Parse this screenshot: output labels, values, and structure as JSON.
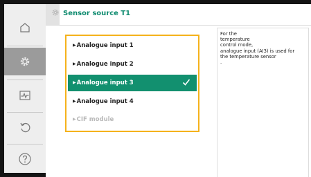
{
  "header": {
    "title": "Sensor source T1",
    "icon": "gear-icon"
  },
  "nav": {
    "items": [
      {
        "name": "home",
        "icon": "home-icon",
        "active": false
      },
      {
        "name": "settings",
        "icon": "gear-icon",
        "active": true
      },
      {
        "name": "diagnostics",
        "icon": "pulse-icon",
        "active": false
      },
      {
        "name": "restore",
        "icon": "undo-icon",
        "active": false
      },
      {
        "name": "help",
        "icon": "help-icon",
        "active": false
      }
    ]
  },
  "options": {
    "items": [
      {
        "label": "Analogue input 1",
        "state": "normal"
      },
      {
        "label": "Analogue input 2",
        "state": "normal"
      },
      {
        "label": "Analogue input 3",
        "state": "selected"
      },
      {
        "label": "Analogue input 4",
        "state": "normal"
      },
      {
        "label": "CIF module",
        "state": "disabled"
      }
    ],
    "focus_color": "#f5b21b",
    "selected_color": "#12906f"
  },
  "info": {
    "text": "For the\ntemperature\ncontrol mode,\nanalogue input (AI3) is used for\nthe temperature sensor\n."
  },
  "colors": {
    "accent": "#0d8a6e",
    "frame": "#141414"
  }
}
